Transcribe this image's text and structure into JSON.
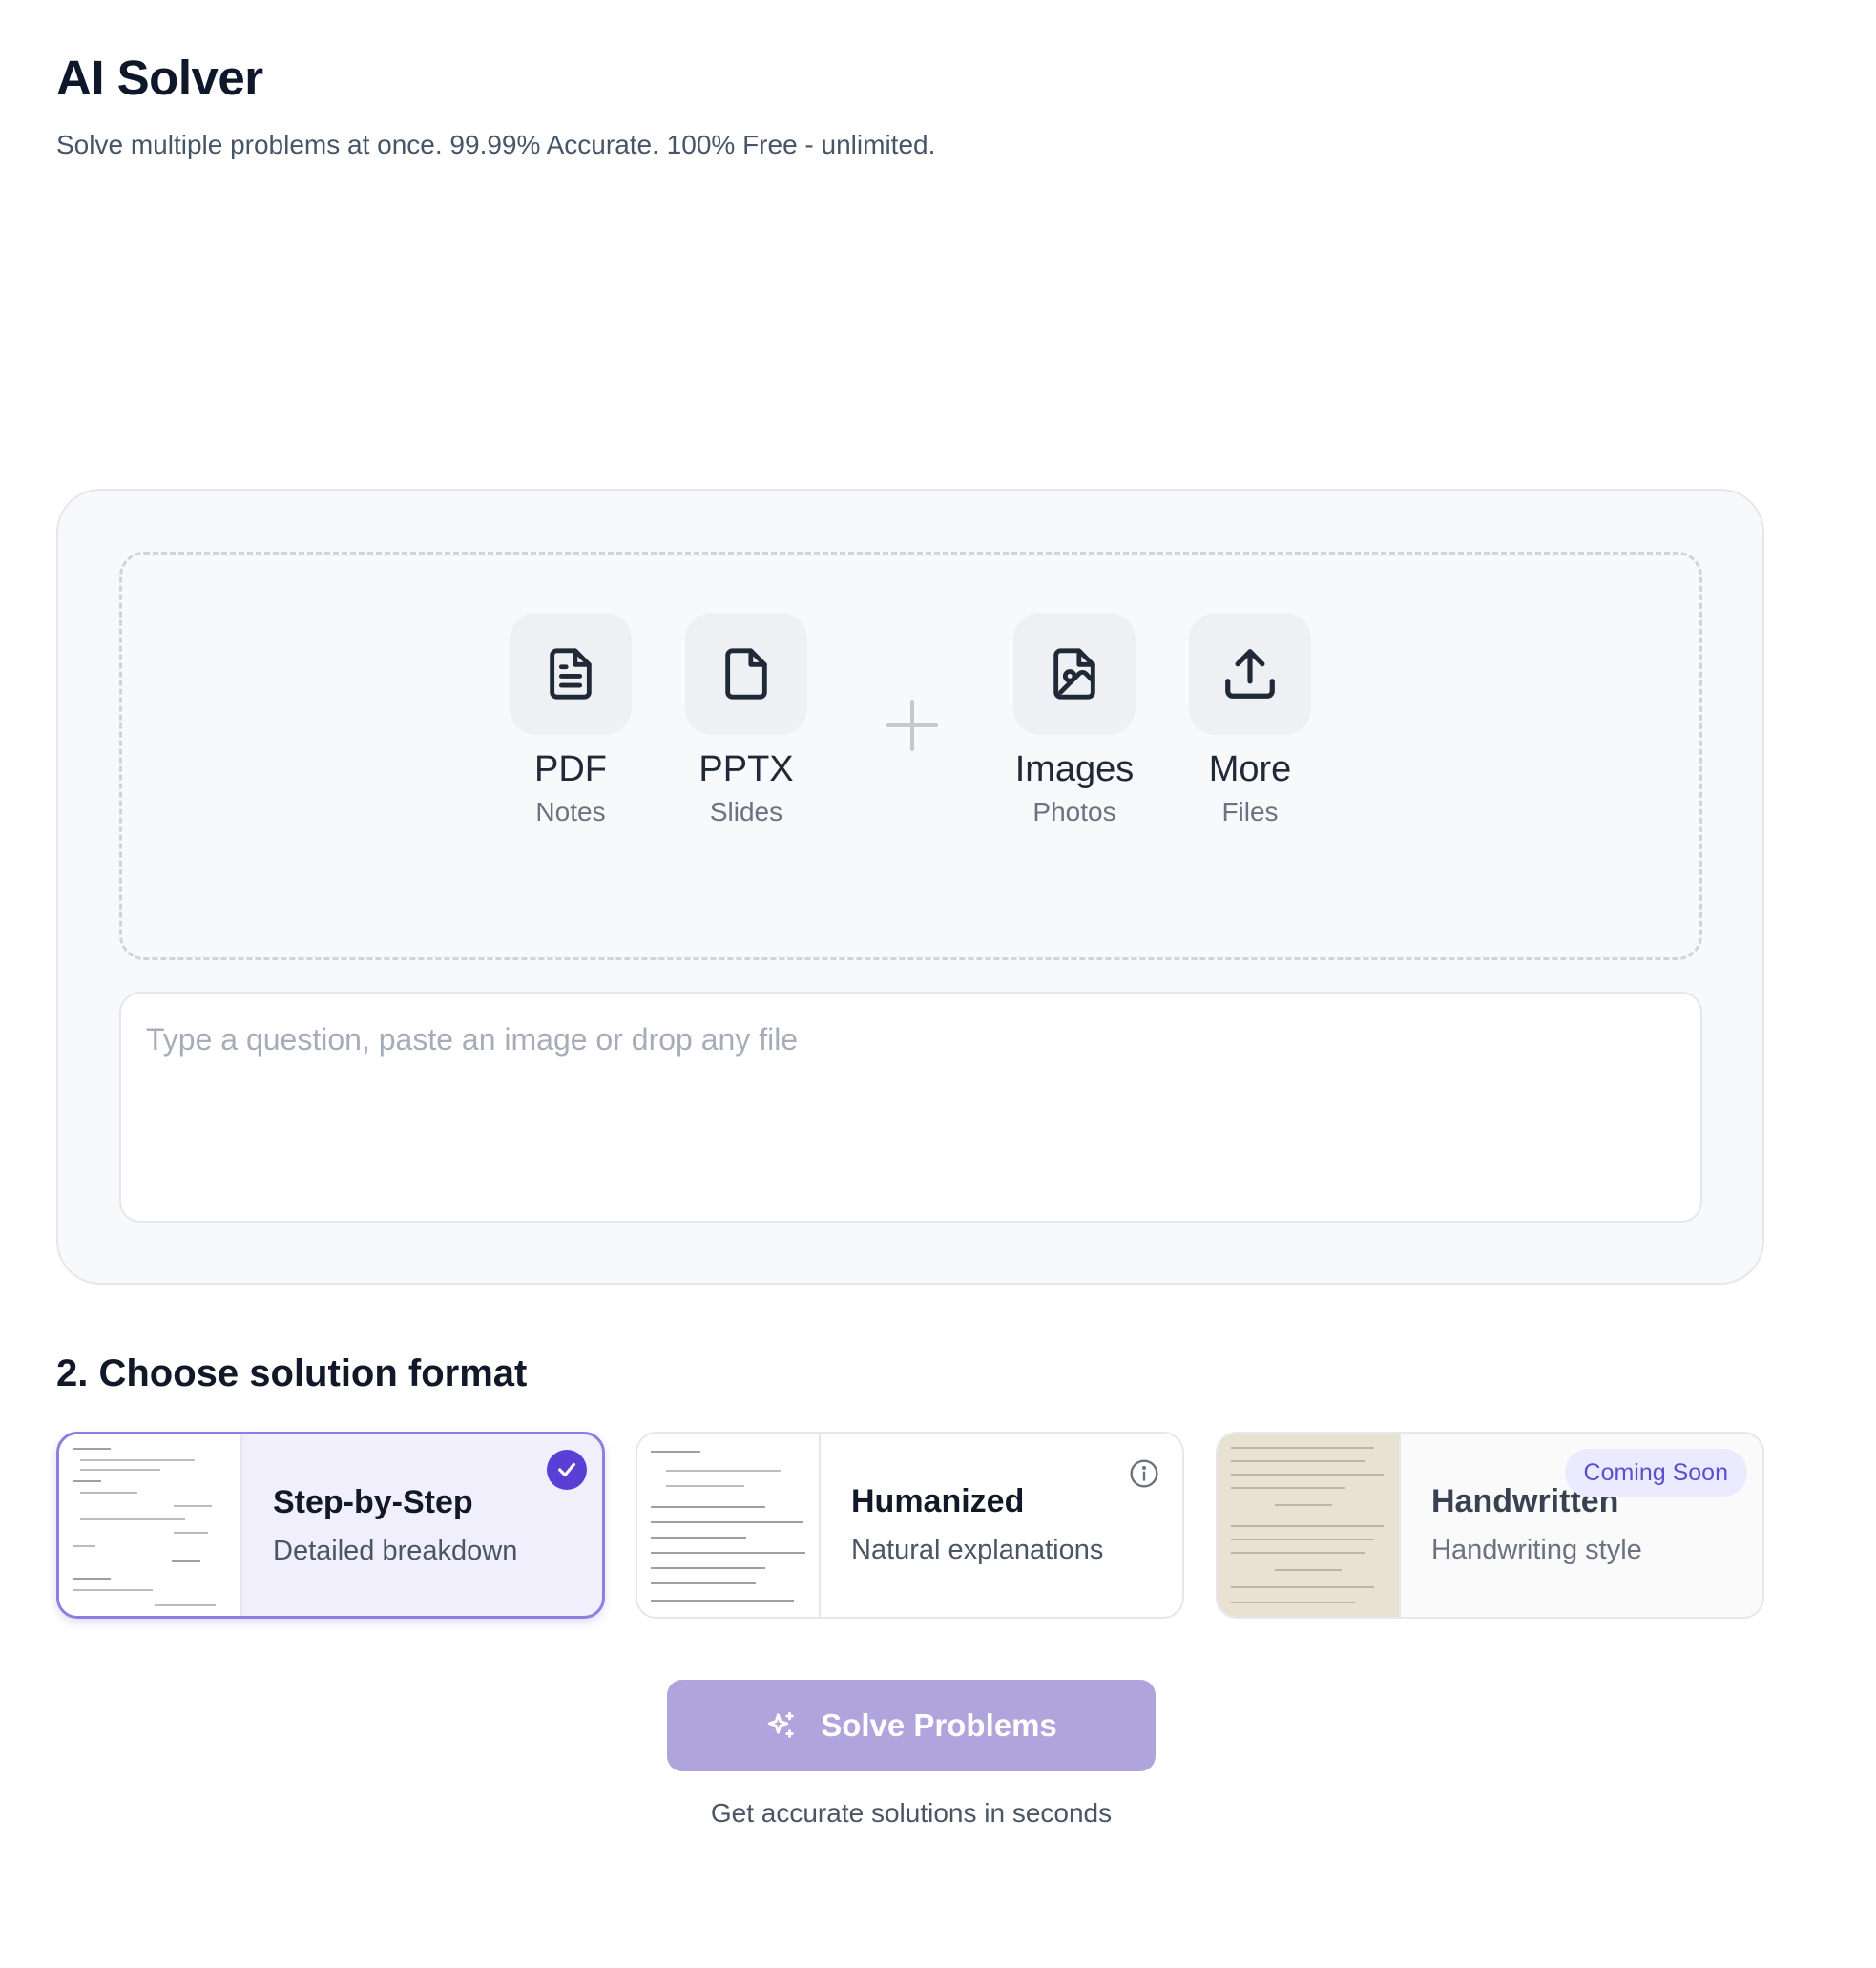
{
  "header": {
    "title": "AI Solver",
    "subtitle": "Solve multiple problems at once. 99.99% Accurate. 100% Free - unlimited."
  },
  "upload": {
    "options": [
      {
        "label": "PDF",
        "sub": "Notes",
        "icon": "pdf-document-icon"
      },
      {
        "label": "PPTX",
        "sub": "Slides",
        "icon": "blank-file-icon"
      },
      {
        "label": "Images",
        "sub": "Photos",
        "icon": "image-file-icon"
      },
      {
        "label": "More",
        "sub": "Files",
        "icon": "upload-icon"
      }
    ],
    "input_placeholder": "Type a question, paste an image or drop any file"
  },
  "format": {
    "heading": "2. Choose solution format",
    "cards": [
      {
        "title": "Step-by-Step",
        "subtitle": "Detailed breakdown",
        "selected": true
      },
      {
        "title": "Humanized",
        "subtitle": "Natural explanations",
        "selected": false
      },
      {
        "title": "Handwritten",
        "subtitle": "Handwriting style",
        "selected": false,
        "badge": "Coming Soon"
      }
    ]
  },
  "action": {
    "button_label": "Solve Problems",
    "hint": "Get accurate solutions in seconds"
  },
  "colors": {
    "accent": "#5a3fd6",
    "button": "#b0a4dc",
    "badge_bg": "#eceafe"
  }
}
